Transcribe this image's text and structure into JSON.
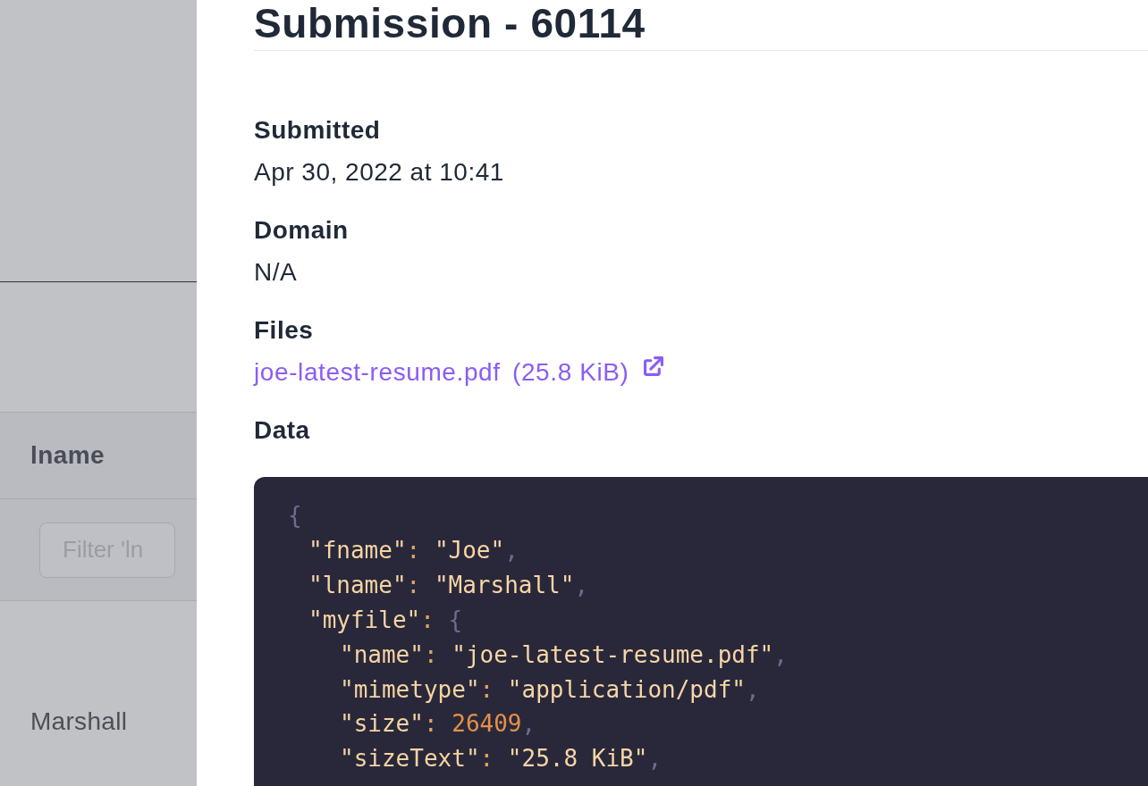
{
  "background_table": {
    "column_header": "lname",
    "filter": {
      "placeholder": "Filter 'ln"
    },
    "rows": [
      {
        "lname": "Marshall"
      }
    ]
  },
  "title": "Submission - 60114",
  "fields": [
    {
      "kind": "text",
      "label": "Submitted",
      "value": "Apr 30, 2022 at 10:41"
    },
    {
      "kind": "text",
      "label": "Domain",
      "value": "N/A"
    },
    {
      "kind": "files",
      "label": "Files",
      "files": [
        {
          "name": "joe-latest-resume.pdf",
          "size": "(25.8 KiB)"
        }
      ]
    },
    {
      "kind": "code",
      "label": "Data",
      "code": [
        {
          "tokens": [
            {
              "kind": "punct",
              "text": "{"
            }
          ],
          "children": [
            {
              "tokens": [
                {
                  "kind": "key",
                  "text": "\"fname\""
                },
                {
                  "kind": "colon",
                  "text": ": "
                },
                {
                  "kind": "string",
                  "text": "\"Joe\""
                },
                {
                  "kind": "punct",
                  "text": ","
                }
              ]
            },
            {
              "tokens": [
                {
                  "kind": "key",
                  "text": "\"lname\""
                },
                {
                  "kind": "colon",
                  "text": ": "
                },
                {
                  "kind": "string",
                  "text": "\"Marshall\""
                },
                {
                  "kind": "punct",
                  "text": ","
                }
              ]
            },
            {
              "tokens": [
                {
                  "kind": "key",
                  "text": "\"myfile\""
                },
                {
                  "kind": "colon",
                  "text": ": "
                },
                {
                  "kind": "punct",
                  "text": "{"
                }
              ],
              "children": [
                {
                  "tokens": [
                    {
                      "kind": "key",
                      "text": "\"name\""
                    },
                    {
                      "kind": "colon",
                      "text": ": "
                    },
                    {
                      "kind": "string",
                      "text": "\"joe-latest-resume.pdf\""
                    },
                    {
                      "kind": "punct",
                      "text": ","
                    }
                  ]
                },
                {
                  "tokens": [
                    {
                      "kind": "key",
                      "text": "\"mimetype\""
                    },
                    {
                      "kind": "colon",
                      "text": ": "
                    },
                    {
                      "kind": "string",
                      "text": "\"application/pdf\""
                    },
                    {
                      "kind": "punct",
                      "text": ","
                    }
                  ]
                },
                {
                  "tokens": [
                    {
                      "kind": "key",
                      "text": "\"size\""
                    },
                    {
                      "kind": "colon",
                      "text": ": "
                    },
                    {
                      "kind": "number",
                      "text": "26409"
                    },
                    {
                      "kind": "punct",
                      "text": ","
                    }
                  ]
                },
                {
                  "tokens": [
                    {
                      "kind": "key",
                      "text": "\"sizeText\""
                    },
                    {
                      "kind": "colon",
                      "text": ": "
                    },
                    {
                      "kind": "string",
                      "text": "\"25.8 KiB\""
                    },
                    {
                      "kind": "punct",
                      "text": ","
                    }
                  ]
                }
              ]
            }
          ]
        }
      ]
    }
  ]
}
